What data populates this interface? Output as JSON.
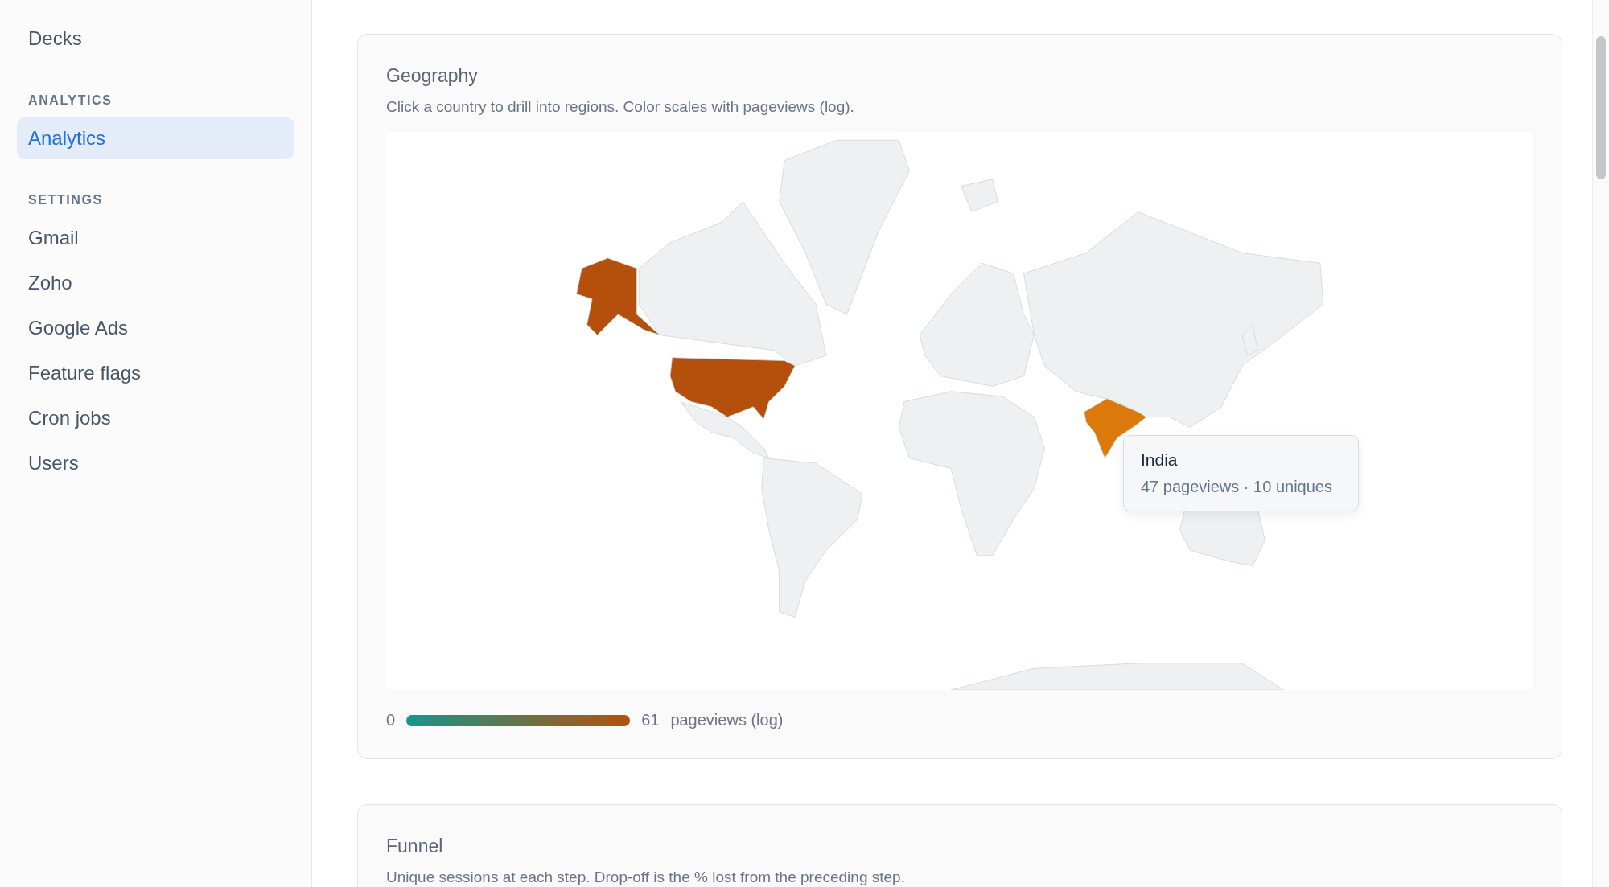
{
  "sidebar": {
    "sections": [
      {
        "items": [
          {
            "label": "Decks",
            "selected": false
          }
        ]
      },
      {
        "title": "ANALYTICS",
        "items": [
          {
            "label": "Analytics",
            "selected": true
          }
        ]
      },
      {
        "title": "SETTINGS",
        "items": [
          {
            "label": "Gmail",
            "selected": false
          },
          {
            "label": "Zoho",
            "selected": false
          },
          {
            "label": "Google Ads",
            "selected": false
          },
          {
            "label": "Feature flags",
            "selected": false
          },
          {
            "label": "Cron jobs",
            "selected": false
          },
          {
            "label": "Users",
            "selected": false
          }
        ]
      }
    ]
  },
  "geography": {
    "title": "Geography",
    "subtitle": "Click a country to drill into regions. Color scales with pageviews (log).",
    "tooltip": {
      "title": "India",
      "detail": "47 pageviews · 10 uniques"
    },
    "legend": {
      "min": "0",
      "max": "61",
      "label": "pageviews (log)"
    }
  },
  "funnel": {
    "title": "Funnel",
    "subtitle": "Unique sessions at each step. Drop-off is the % lost from the preceding step."
  }
}
